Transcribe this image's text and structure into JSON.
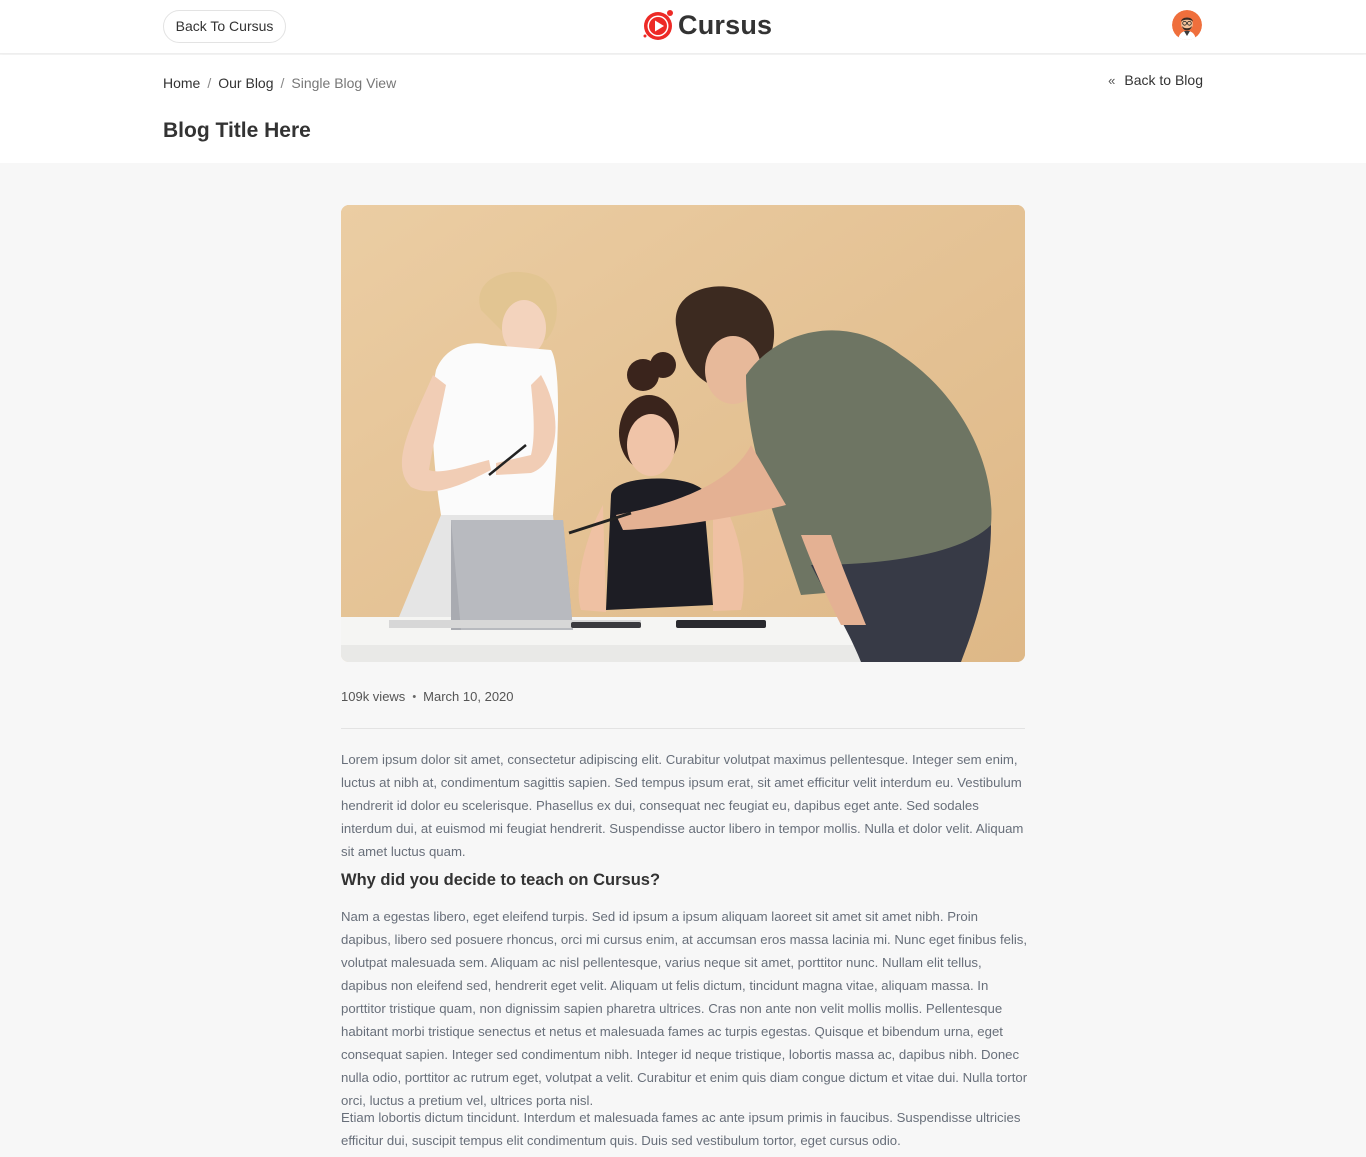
{
  "header": {
    "back_label": "Back To Cursus",
    "logo_text": "Cursus",
    "brand_color": "#ed2a26"
  },
  "breadcrumb": {
    "items": [
      "Home",
      "Our Blog",
      "Single Blog View"
    ],
    "separator": "/"
  },
  "back_to_blog": {
    "icon": "«",
    "label": "Back to Blog"
  },
  "page_title": "Blog Title Here",
  "article": {
    "image_alt": "three people working around a laptop",
    "views": "109k views",
    "dot": "•",
    "date": "March 10, 2020",
    "intro": "Lorem ipsum dolor sit amet, consectetur adipiscing elit. Curabitur volutpat maximus pellentesque. Integer sem enim, luctus at nibh at, condimentum sagittis sapien. Sed tempus ipsum erat, sit amet efficitur velit interdum eu. Vestibulum hendrerit id dolor eu scelerisque. Phasellus ex dui, consequat nec feugiat eu, dapibus eget ante. Sed sodales interdum dui, at euismod mi feugiat hendrerit. Suspendisse auctor libero in tempor mollis. Nulla et dolor velit. Aliquam sit amet luctus quam.",
    "heading": "Why did you decide to teach on Cursus?",
    "body": "Nam a egestas libero, eget eleifend turpis. Sed id ipsum a ipsum aliquam laoreet sit amet sit amet nibh. Proin dapibus, libero sed posuere rhoncus, orci mi cursus enim, at accumsan eros massa lacinia mi. Nunc eget finibus felis, volutpat malesuada sem. Aliquam ac nisl pellentesque, varius neque sit amet, porttitor nunc. Nullam elit tellus, dapibus non eleifend sed, hendrerit eget velit. Aliquam ut felis dictum, tincidunt magna vitae, aliquam massa. In porttitor tristique quam, non dignissim sapien pharetra ultrices. Cras non ante non velit mollis mollis. Pellentesque habitant morbi tristique senectus et netus et malesuada fames ac turpis egestas. Quisque et bibendum urna, eget consequat sapien. Integer sed condimentum nibh. Integer id neque tristique, lobortis massa ac, dapibus nibh. Donec nulla odio, porttitor ac rutrum eget, volutpat a velit. Curabitur et enim quis diam congue dictum et vitae dui. Nulla tortor orci, luctus a pretium vel, ultrices porta nisl.",
    "closing": "Etiam lobortis dictum tincidunt. Interdum et malesuada fames ac ante ipsum primis in faucibus. Suspendisse ultricies efficitur dui, suscipit tempus elit condimentum quis. Duis sed vestibulum tortor, eget cursus odio."
  }
}
